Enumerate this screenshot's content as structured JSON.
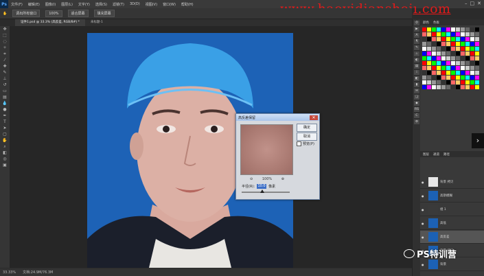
{
  "app": {
    "logo": "Ps",
    "menu": [
      "文件(F)",
      "编辑(E)",
      "图像(I)",
      "图层(L)",
      "文字(Y)",
      "选择(S)",
      "滤镜(T)",
      "3D(D)",
      "视图(V)",
      "窗口(W)",
      "帮助(H)"
    ],
    "window_controls": [
      "–",
      "□",
      "✕"
    ]
  },
  "watermark": "www.haoyidianshejı.com",
  "options_bar": {
    "items": [
      "调出所有窗口",
      "100%",
      "适合屏幕",
      "填充屏幕"
    ]
  },
  "tabs": [
    {
      "label": "证件1.psd @ 33.3% (高反差, RGB/8#) *",
      "active": true
    },
    {
      "label": "未标题-1",
      "active": false
    }
  ],
  "status": {
    "zoom": "33.33%",
    "doc": "文档:24.9M/76.3M"
  },
  "dialog": {
    "title": "高反差保留",
    "ok_label": "确定",
    "cancel_label": "取消",
    "preview_label": "预览(P)",
    "zoom_percent": "100%",
    "radius_label": "半径(R):",
    "radius_value": "10.0",
    "unit_label": "像素"
  },
  "right_panel": {
    "swatch_tabs": [
      "颜色",
      "色板"
    ],
    "layers_tabs": [
      "图层",
      "通道",
      "路径"
    ],
    "swatch_colors": [
      "#ff0000",
      "#ffff00",
      "#00ff00",
      "#00ffff",
      "#0000ff",
      "#ff00ff",
      "#ffffff",
      "#cccccc",
      "#999999",
      "#666666",
      "#333333",
      "#000000",
      "#ff6666",
      "#ffcc66"
    ],
    "layers": [
      {
        "name": "背景 拷贝",
        "thumb": "#e6e6e6",
        "selected": false
      },
      {
        "name": "高斯模糊",
        "thumb": "#1c61b4",
        "selected": false
      },
      {
        "name": "组 1",
        "thumb": "#3a3a3a",
        "selected": false
      },
      {
        "name": "高低",
        "thumb": "#1c61b4",
        "selected": false
      },
      {
        "name": "高反差",
        "thumb": "#1c61b4",
        "selected": true
      },
      {
        "name": "背景 拷贝",
        "thumb": "#1c61b4",
        "selected": false
      },
      {
        "name": "背景",
        "thumb": "#1c61b4",
        "selected": false
      }
    ]
  },
  "brand": "PS特训营"
}
